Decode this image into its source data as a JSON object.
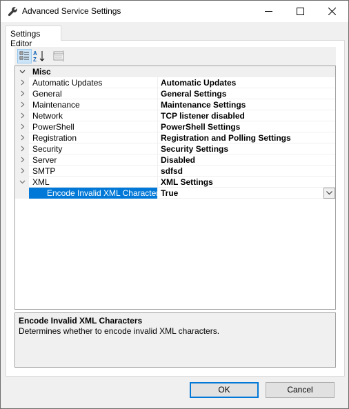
{
  "window": {
    "title": "Advanced Service Settings",
    "title_icon": "wrench-icon"
  },
  "tabs": [
    {
      "label": "Settings Editor"
    }
  ],
  "toolbar": {
    "categorized_icon": "categorized-view-icon",
    "alphabetical_icon": "alphabetical-sort-icon",
    "property_pages_icon": "property-pages-icon"
  },
  "grid": {
    "category": "Misc",
    "rows": [
      {
        "name": "Automatic Updates",
        "value": "Automatic Updates",
        "expanded": false
      },
      {
        "name": "General",
        "value": "General Settings",
        "expanded": false
      },
      {
        "name": "Maintenance",
        "value": "Maintenance Settings",
        "expanded": false
      },
      {
        "name": "Network",
        "value": "TCP listener disabled",
        "expanded": false
      },
      {
        "name": "PowerShell",
        "value": "PowerShell Settings",
        "expanded": false
      },
      {
        "name": "Registration",
        "value": "Registration and Polling Settings",
        "expanded": false
      },
      {
        "name": "Security",
        "value": "Security Settings",
        "expanded": false
      },
      {
        "name": "Server",
        "value": "Disabled",
        "expanded": false
      },
      {
        "name": "SMTP",
        "value": "sdfsd",
        "expanded": false
      },
      {
        "name": "XML",
        "value": "XML Settings",
        "expanded": true
      }
    ],
    "child": {
      "name": "Encode Invalid XML Characters",
      "value": "True"
    }
  },
  "help": {
    "title": "Encode Invalid XML Characters",
    "description": "Determines whether to encode invalid XML characters."
  },
  "buttons": {
    "ok": "OK",
    "cancel": "Cancel"
  },
  "colors": {
    "selection": "#0078d7",
    "category_background": "#f0f0f0"
  }
}
